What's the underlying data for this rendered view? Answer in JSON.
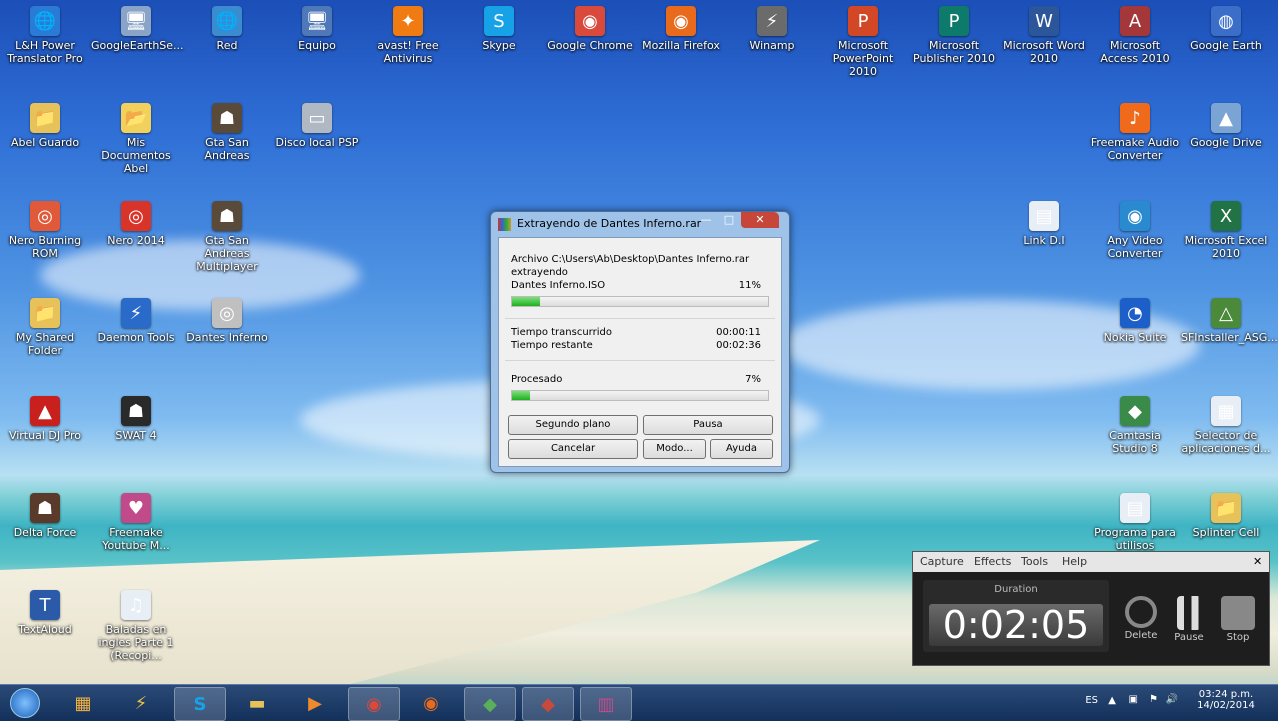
{
  "desktop": {
    "icons": [
      {
        "label": "L&H Power Translator Pro",
        "glyph": "🌐",
        "color": "#2a7bd6"
      },
      {
        "label": "GoogleEarthSe...",
        "glyph": "🖥",
        "color": "#8aa4c8"
      },
      {
        "label": "Red",
        "glyph": "🌐",
        "color": "#3a8bd0"
      },
      {
        "label": "Equipo",
        "glyph": "🖥",
        "color": "#4f78b8"
      },
      {
        "label": "avast! Free Antivirus",
        "glyph": "✦",
        "color": "#f07b12"
      },
      {
        "label": "Skype",
        "glyph": "S",
        "color": "#17a2e8"
      },
      {
        "label": "Google Chrome",
        "glyph": "◉",
        "color": "#d94a3c"
      },
      {
        "label": "Mozilla Firefox",
        "glyph": "◉",
        "color": "#e86a1c"
      },
      {
        "label": "Winamp",
        "glyph": "⚡",
        "color": "#6b6b6b"
      },
      {
        "label": "Microsoft PowerPoint 2010",
        "glyph": "P",
        "color": "#d24726"
      },
      {
        "label": "Microsoft Publisher 2010",
        "glyph": "P",
        "color": "#0e7a6b"
      },
      {
        "label": "Microsoft Word 2010",
        "glyph": "W",
        "color": "#2b579a"
      },
      {
        "label": "Microsoft Access 2010",
        "glyph": "A",
        "color": "#a4373a"
      },
      {
        "label": "Google Earth",
        "glyph": "◍",
        "color": "#3a6ec8"
      },
      {
        "label": "Abel Guardo",
        "glyph": "📁",
        "color": "#e7c15a"
      },
      {
        "label": "Mis Documentos Abel",
        "glyph": "📂",
        "color": "#f2d05c"
      },
      {
        "label": "Gta San Andreas",
        "glyph": "☗",
        "color": "#5a4a3a"
      },
      {
        "label": "Disco local PSP",
        "glyph": "▭",
        "color": "#b0b8c4"
      },
      {
        "label": "Freemake Audio Converter",
        "glyph": "♪",
        "color": "#f06a1c"
      },
      {
        "label": "Google Drive",
        "glyph": "▲",
        "color": "#7aa4d4"
      },
      {
        "label": "Nero Burning ROM",
        "glyph": "◎",
        "color": "#e05a3a"
      },
      {
        "label": "Nero 2014",
        "glyph": "◎",
        "color": "#d8342a"
      },
      {
        "label": "Gta San Andreas Multiplayer",
        "glyph": "☗",
        "color": "#5a4a3a"
      },
      {
        "label": "Link D.I",
        "glyph": "▤",
        "color": "#e8eef6"
      },
      {
        "label": "Any Video Converter",
        "glyph": "◉",
        "color": "#2a8ad0"
      },
      {
        "label": "Microsoft Excel 2010",
        "glyph": "X",
        "color": "#217346"
      },
      {
        "label": "My Shared Folder",
        "glyph": "📁",
        "color": "#e7c15a"
      },
      {
        "label": "Daemon Tools",
        "glyph": "⚡",
        "color": "#2a6ac8"
      },
      {
        "label": "Dantes Inferno",
        "glyph": "◎",
        "color": "#c0c0c0"
      },
      {
        "label": "Nokia Suite",
        "glyph": "◔",
        "color": "#1c5fc8"
      },
      {
        "label": "SFInstaller_ASG...",
        "glyph": "△",
        "color": "#4a8a3a"
      },
      {
        "label": "Virtual DJ Pro",
        "glyph": "▲",
        "color": "#c8201c"
      },
      {
        "label": "SWAT 4",
        "glyph": "☗",
        "color": "#2a2a2a"
      },
      {
        "label": "Camtasia Studio 8",
        "glyph": "◆",
        "color": "#3a8a4a"
      },
      {
        "label": "Selector de aplicaciones d...",
        "glyph": "▦",
        "color": "#e8eef6"
      },
      {
        "label": "Delta Force",
        "glyph": "☗",
        "color": "#5a3a2a"
      },
      {
        "label": "Freemake Youtube M...",
        "glyph": "♥",
        "color": "#c04a8a"
      },
      {
        "label": "Programa para utilisos",
        "glyph": "▤",
        "color": "#e8eef6"
      },
      {
        "label": "Splinter Cell",
        "glyph": "📁",
        "color": "#e7c15a"
      },
      {
        "label": "TextAloud",
        "glyph": "T",
        "color": "#2a5aa8"
      },
      {
        "label": "Baladas en ingles Parte 1 (Recopi...",
        "glyph": "♫",
        "color": "#e8eef6"
      }
    ]
  },
  "dialog": {
    "title": "Extrayendo de Dantes Inferno.rar",
    "minimize": "—",
    "maximize": "□",
    "close": "✕",
    "archive_line": "Archivo C:\\Users\\Ab\\Desktop\\Dantes Inferno.rar",
    "action": "extrayendo",
    "file": "Dantes Inferno.ISO",
    "file_percent": "11%",
    "file_progress": 0.11,
    "elapsed_label": "Tiempo transcurrido",
    "elapsed": "00:00:11",
    "remaining_label": "Tiempo restante",
    "remaining": "00:02:36",
    "processed_label": "Procesado",
    "processed_percent": "7%",
    "processed_progress": 0.07,
    "buttons": {
      "background": "Segundo plano",
      "pause": "Pausa",
      "cancel": "Cancelar",
      "mode": "Modo...",
      "help": "Ayuda"
    }
  },
  "recorder": {
    "menu": [
      "Capture",
      "Effects",
      "Tools",
      "Help"
    ],
    "close": "✕",
    "duration_label": "Duration",
    "duration": "0:02:05",
    "delete": "Delete",
    "pause": "Pause",
    "stop": "Stop"
  },
  "taskbar": {
    "language": "ES",
    "time": "03:24 p.m.",
    "date": "14/02/2014",
    "apps": [
      "start-orb",
      "apps-grid",
      "winamp",
      "skype",
      "explorer",
      "media",
      "chrome",
      "firefox",
      "camtasia-studio",
      "camtasia-recorder",
      "winrar"
    ]
  }
}
